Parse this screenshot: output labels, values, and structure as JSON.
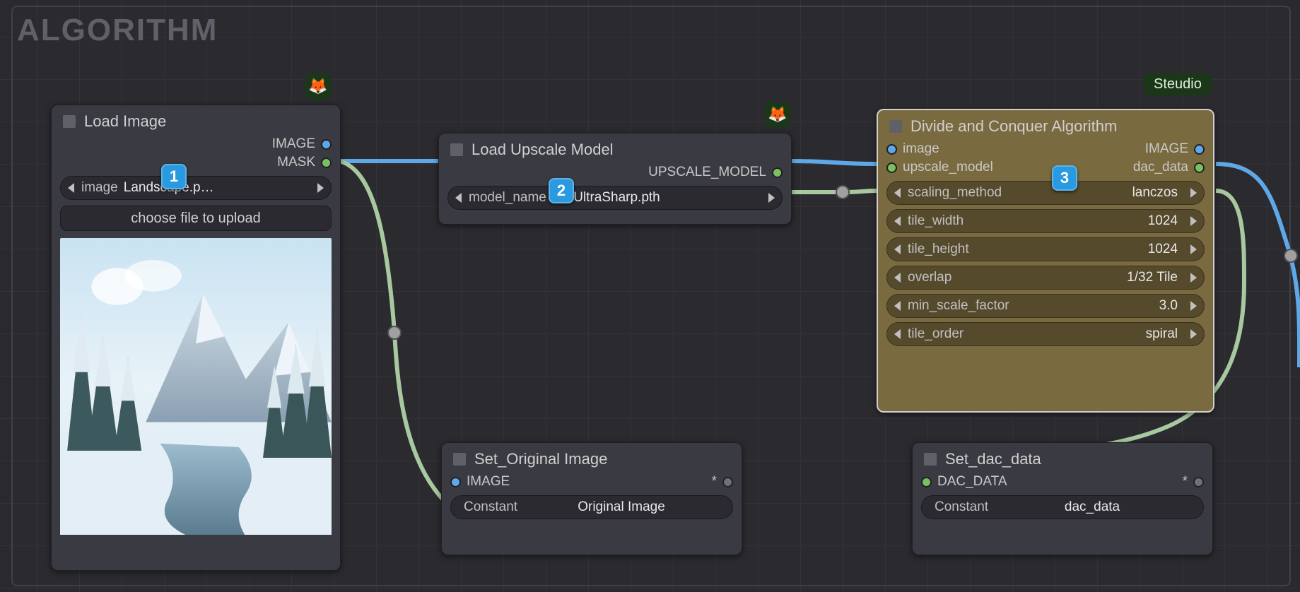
{
  "group": {
    "title": "ALGORITHM"
  },
  "tags": {
    "steudio": "Steudio"
  },
  "annotations": [
    "1",
    "2",
    "3"
  ],
  "nodes": {
    "load_image": {
      "title": "Load Image",
      "outputs": [
        "IMAGE",
        "MASK"
      ],
      "widgets": {
        "image": {
          "name": "image",
          "value": "Landscape.p…"
        },
        "choose_file": "choose file to upload"
      }
    },
    "load_upscale": {
      "title": "Load Upscale Model",
      "outputs": [
        "UPSCALE_MODEL"
      ],
      "widgets": {
        "model_name": {
          "name": "model_name",
          "value": "4x-UltraSharp.pth"
        }
      }
    },
    "dac": {
      "title": "Divide and Conquer Algorithm",
      "inputs": [
        "image",
        "upscale_model"
      ],
      "outputs": [
        "IMAGE",
        "dac_data"
      ],
      "widgets": {
        "scaling_method": {
          "name": "scaling_method",
          "value": "lanczos"
        },
        "tile_width": {
          "name": "tile_width",
          "value": "1024"
        },
        "tile_height": {
          "name": "tile_height",
          "value": "1024"
        },
        "overlap": {
          "name": "overlap",
          "value": "1/32 Tile"
        },
        "min_scale_factor": {
          "name": "min_scale_factor",
          "value": "3.0"
        },
        "tile_order": {
          "name": "tile_order",
          "value": "spiral"
        }
      }
    },
    "set_original": {
      "title": "Set_Original Image",
      "inputs": [
        "IMAGE"
      ],
      "outputs": [
        "*"
      ],
      "widgets": {
        "constant": {
          "name": "Constant",
          "value": "Original Image"
        }
      }
    },
    "set_dac": {
      "title": "Set_dac_data",
      "inputs": [
        "DAC_DATA"
      ],
      "outputs": [
        "*"
      ],
      "widgets": {
        "constant": {
          "name": "Constant",
          "value": "dac_data"
        }
      }
    }
  },
  "colors": {
    "edge_blue": "#5fa8e8",
    "edge_green": "#a8c8a0",
    "accent_badge": "#2a9ae0",
    "selected_fill": "#7a6a3f"
  }
}
